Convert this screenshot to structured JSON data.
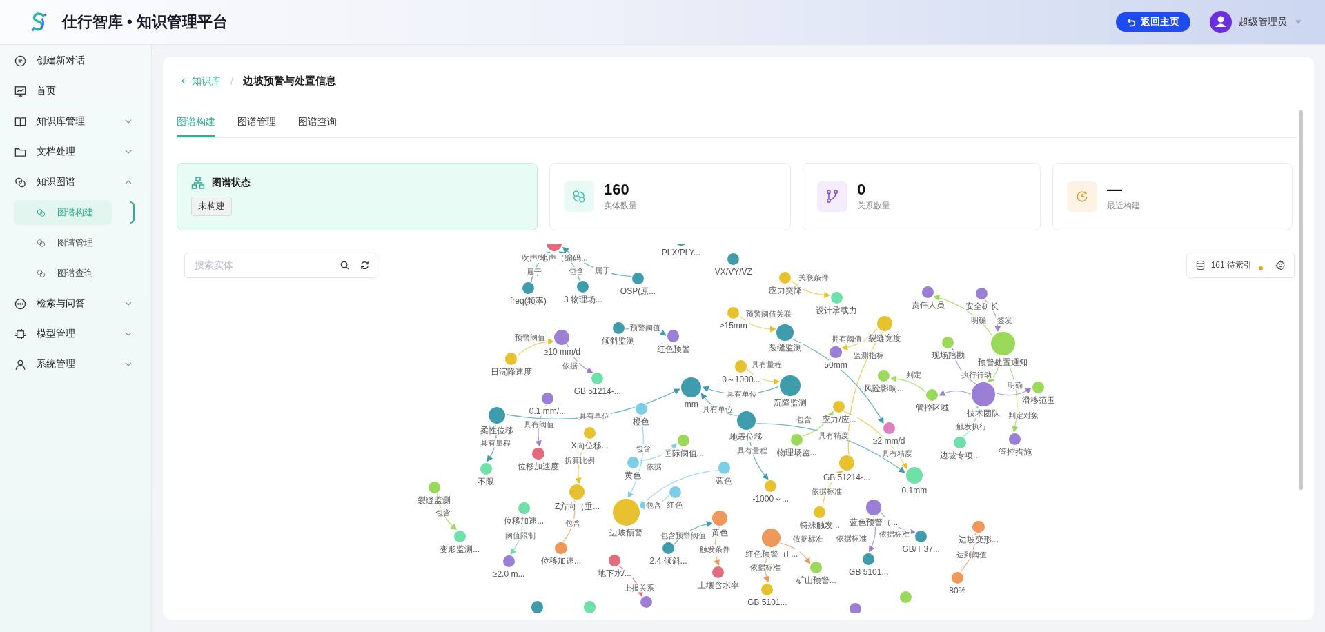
{
  "header": {
    "title": "仕行智库 • 知识管理平台",
    "home_button": "返回主页",
    "user": "超级管理员"
  },
  "sidebar": {
    "items": [
      {
        "label": "创建新对话"
      },
      {
        "label": "首页"
      },
      {
        "label": "知识库管理",
        "expanded": false
      },
      {
        "label": "文档处理",
        "expanded": false
      },
      {
        "label": "知识图谱",
        "expanded": true,
        "children": [
          {
            "label": "图谱构建",
            "selected": true
          },
          {
            "label": "图谱管理",
            "selected": false
          },
          {
            "label": "图谱查询",
            "selected": false
          }
        ]
      },
      {
        "label": "检索与问答",
        "expanded": false
      },
      {
        "label": "模型管理",
        "expanded": false
      },
      {
        "label": "系统管理",
        "expanded": false
      }
    ]
  },
  "breadcrumb": {
    "back": "知识库",
    "separator": "/",
    "current": "边坡预警与处置信息"
  },
  "tabs": [
    {
      "label": "图谱构建",
      "selected": true
    },
    {
      "label": "图谱管理",
      "selected": false
    },
    {
      "label": "图谱查询",
      "selected": false
    }
  ],
  "status_card": {
    "title": "图谱状态",
    "badge": "未构建"
  },
  "stats": [
    {
      "value": "160",
      "label": "实体数量"
    },
    {
      "value": "0",
      "label": "关系数量"
    },
    {
      "value": "—",
      "label": "最近构建"
    }
  ],
  "search": {
    "placeholder": "搜索实体"
  },
  "index_status": {
    "text": "161 待索引"
  },
  "graph": {
    "nodes": [
      {
        "label": "次声/地声（编码...",
        "color": "#e36b7c"
      },
      {
        "label": "freq(频率)",
        "color": "#3f9cad"
      },
      {
        "label": "3 物理场...",
        "color": "#3f9cad"
      },
      {
        "label": "OSP(原...",
        "color": "#3f9cad"
      },
      {
        "label": "PLX/PLY...",
        "color": "#3f9cad"
      },
      {
        "label": "VX/VY/VZ",
        "color": "#3f9cad"
      },
      {
        "label": "应力突降",
        "color": "#e8c12f"
      },
      {
        "label": "设计承载力",
        "color": "#6ee0a8"
      },
      {
        "label": "日沉降速度",
        "color": "#e8c12f"
      },
      {
        "label": "≥10 mm/d",
        "color": "#9b7fd4"
      },
      {
        "label": "倾斜监测",
        "color": "#3f9cad"
      },
      {
        "label": "红色预警",
        "color": "#9b7fd4"
      },
      {
        "label": "GB 51214-...",
        "color": "#6ee0a8"
      },
      {
        "label": "mm",
        "color": "#3f9cad"
      },
      {
        "label": "0～1000...",
        "color": "#e8c12f"
      },
      {
        "label": "沉降监测",
        "color": "#3f9cad"
      },
      {
        "label": "≥15mm",
        "color": "#e8c12f"
      },
      {
        "label": "裂缝监测",
        "color": "#3f9cad"
      },
      {
        "label": "裂缝宽度",
        "color": "#e8c12f"
      },
      {
        "label": "50mm",
        "color": "#9b7fd4"
      },
      {
        "label": "0.1 mm/...",
        "color": "#9b7fd4"
      },
      {
        "label": "柔性位移",
        "color": "#3f9cad"
      },
      {
        "label": "地表位移",
        "color": "#3f9cad"
      },
      {
        "label": "橙色",
        "color": "#7dcfe8"
      },
      {
        "label": "国际阈值...",
        "color": "#9bd95a"
      },
      {
        "label": "黄色",
        "color": "#7dcfe8"
      },
      {
        "label": "蓝色",
        "color": "#7dcfe8"
      },
      {
        "label": "红色",
        "color": "#7dcfe8"
      },
      {
        "label": "边坡预警",
        "color": "#e8c12f"
      },
      {
        "label": "X向位移...",
        "color": "#e8c12f"
      },
      {
        "label": "Z方向（垂...",
        "color": "#e8c12f"
      },
      {
        "label": "位移加速度",
        "color": "#e36b7c"
      },
      {
        "label": "不限",
        "color": "#6ee0a8"
      },
      {
        "label": "裂缝监测",
        "color": "#9bd95a"
      },
      {
        "label": "变形监测...",
        "color": "#6ee0a8"
      },
      {
        "label": "位移加速...",
        "color": "#6ee0a8"
      },
      {
        "label": "≥2.0 m...",
        "color": "#9b7fd4"
      },
      {
        "label": "位移加速...",
        "color": "#f0975a"
      },
      {
        "label": "地下水/...",
        "color": "#e36b7c"
      },
      {
        "label": "黄色",
        "color": "#f0975a"
      },
      {
        "label": "2.4 倾斜...",
        "color": "#3f9cad"
      },
      {
        "label": "土壤含水率",
        "color": "#e36b7c"
      },
      {
        "label": "红色预警（I ...",
        "color": "#f0975a"
      },
      {
        "label": "矿山预警...",
        "color": "#9bd95a"
      },
      {
        "label": "GB 5101...",
        "color": "#e8c12f"
      },
      {
        "label": "应力/应...",
        "color": "#e8c12f"
      },
      {
        "label": "物理场监...",
        "color": "#9bd95a"
      },
      {
        "label": "GB 51214-...",
        "color": "#e8c12f"
      },
      {
        "label": "-1000～...",
        "color": "#e8c12f"
      },
      {
        "label": "特殊触发...",
        "color": "#e8c12f"
      },
      {
        "label": "蓝色预警（...",
        "color": "#9b7fd4"
      },
      {
        "label": "GB/T 37...",
        "color": "#3f9cad"
      },
      {
        "label": "GB 5101...",
        "color": "#3f9cad"
      },
      {
        "label": "0.1mm",
        "color": "#6ee0a8"
      },
      {
        "label": "风险影响...",
        "color": "#9bd95a"
      },
      {
        "label": "≥2 mm/d",
        "color": "#e07fc0"
      },
      {
        "label": "管控区域",
        "color": "#9bd95a"
      },
      {
        "label": "技术团队",
        "color": "#9b7fd4"
      },
      {
        "label": "责任人员",
        "color": "#9b7fd4"
      },
      {
        "label": "安全矿长",
        "color": "#9b7fd4"
      },
      {
        "label": "预警处置通知",
        "color": "#9bd95a"
      },
      {
        "label": "现场踏勘",
        "color": "#9bd95a"
      },
      {
        "label": "滑移范围",
        "color": "#9bd95a"
      },
      {
        "label": "边坡专项...",
        "color": "#6ee0a8"
      },
      {
        "label": "管控措施",
        "color": "#9b7fd4"
      },
      {
        "label": "边坡变形...",
        "color": "#f0975a"
      },
      {
        "label": "80%",
        "color": "#f0975a"
      },
      {
        "color": "#3f9cad"
      },
      {
        "color": "#6ee0a8"
      },
      {
        "color": "#9b7fd4"
      },
      {
        "color": "#9bd95a"
      },
      {
        "color": "#9b7fd4"
      }
    ],
    "edges": [
      {
        "label": "属于"
      },
      {
        "label": "包含"
      },
      {
        "label": "属于"
      },
      {
        "label": "关联条件"
      },
      {
        "label": "预警阈值"
      },
      {
        "label": "依据"
      },
      {
        "label": "预警阈值"
      },
      {
        "label": "预警阈值关联"
      },
      {
        "label": "拥有阈值"
      },
      {
        "label": "具有单位"
      },
      {
        "label": "具有单位"
      },
      {
        "label": "具有量程"
      },
      {
        "label": "具有单位"
      },
      {
        "label": "具有量程"
      },
      {
        "label": "具有精度"
      },
      {
        "label": "包含"
      },
      {
        "label": "监测指标"
      },
      {
        "label": "具有阈值"
      },
      {
        "label": "具有量程"
      },
      {
        "label": "折算比例"
      },
      {
        "label": "包含"
      },
      {
        "label": "依据"
      },
      {
        "label": "包含"
      },
      {
        "label": "包含"
      },
      {
        "label": "阈值限制"
      },
      {
        "label": "包含"
      },
      {
        "label": "包含预警阈值"
      },
      {
        "label": "触发条件"
      },
      {
        "label": "依据标准"
      },
      {
        "label": "依据标准"
      },
      {
        "label": "依据标准"
      },
      {
        "label": "依据标准"
      },
      {
        "label": "依据标准"
      },
      {
        "label": "达到阈值"
      },
      {
        "label": "上报关系"
      },
      {
        "label": "明确"
      },
      {
        "label": "签发"
      },
      {
        "label": "判定"
      },
      {
        "label": "执行行动"
      },
      {
        "label": "判定对象"
      },
      {
        "label": "明确"
      },
      {
        "label": "触发执行"
      },
      {
        "label": "具有精度"
      }
    ]
  }
}
